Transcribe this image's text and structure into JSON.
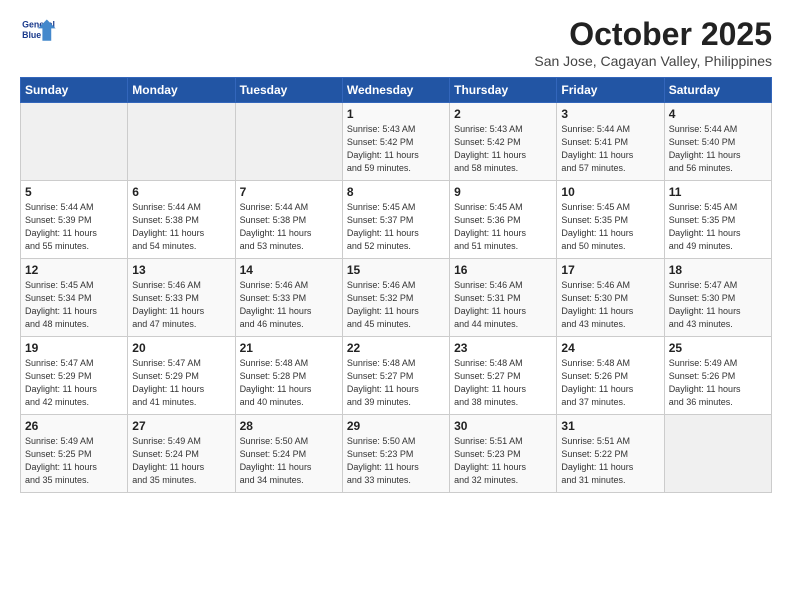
{
  "header": {
    "logo_line1": "General",
    "logo_line2": "Blue",
    "month": "October 2025",
    "location": "San Jose, Cagayan Valley, Philippines"
  },
  "weekdays": [
    "Sunday",
    "Monday",
    "Tuesday",
    "Wednesday",
    "Thursday",
    "Friday",
    "Saturday"
  ],
  "weeks": [
    [
      {
        "day": "",
        "info": ""
      },
      {
        "day": "",
        "info": ""
      },
      {
        "day": "",
        "info": ""
      },
      {
        "day": "1",
        "info": "Sunrise: 5:43 AM\nSunset: 5:42 PM\nDaylight: 11 hours\nand 59 minutes."
      },
      {
        "day": "2",
        "info": "Sunrise: 5:43 AM\nSunset: 5:42 PM\nDaylight: 11 hours\nand 58 minutes."
      },
      {
        "day": "3",
        "info": "Sunrise: 5:44 AM\nSunset: 5:41 PM\nDaylight: 11 hours\nand 57 minutes."
      },
      {
        "day": "4",
        "info": "Sunrise: 5:44 AM\nSunset: 5:40 PM\nDaylight: 11 hours\nand 56 minutes."
      }
    ],
    [
      {
        "day": "5",
        "info": "Sunrise: 5:44 AM\nSunset: 5:39 PM\nDaylight: 11 hours\nand 55 minutes."
      },
      {
        "day": "6",
        "info": "Sunrise: 5:44 AM\nSunset: 5:38 PM\nDaylight: 11 hours\nand 54 minutes."
      },
      {
        "day": "7",
        "info": "Sunrise: 5:44 AM\nSunset: 5:38 PM\nDaylight: 11 hours\nand 53 minutes."
      },
      {
        "day": "8",
        "info": "Sunrise: 5:45 AM\nSunset: 5:37 PM\nDaylight: 11 hours\nand 52 minutes."
      },
      {
        "day": "9",
        "info": "Sunrise: 5:45 AM\nSunset: 5:36 PM\nDaylight: 11 hours\nand 51 minutes."
      },
      {
        "day": "10",
        "info": "Sunrise: 5:45 AM\nSunset: 5:35 PM\nDaylight: 11 hours\nand 50 minutes."
      },
      {
        "day": "11",
        "info": "Sunrise: 5:45 AM\nSunset: 5:35 PM\nDaylight: 11 hours\nand 49 minutes."
      }
    ],
    [
      {
        "day": "12",
        "info": "Sunrise: 5:45 AM\nSunset: 5:34 PM\nDaylight: 11 hours\nand 48 minutes."
      },
      {
        "day": "13",
        "info": "Sunrise: 5:46 AM\nSunset: 5:33 PM\nDaylight: 11 hours\nand 47 minutes."
      },
      {
        "day": "14",
        "info": "Sunrise: 5:46 AM\nSunset: 5:33 PM\nDaylight: 11 hours\nand 46 minutes."
      },
      {
        "day": "15",
        "info": "Sunrise: 5:46 AM\nSunset: 5:32 PM\nDaylight: 11 hours\nand 45 minutes."
      },
      {
        "day": "16",
        "info": "Sunrise: 5:46 AM\nSunset: 5:31 PM\nDaylight: 11 hours\nand 44 minutes."
      },
      {
        "day": "17",
        "info": "Sunrise: 5:46 AM\nSunset: 5:30 PM\nDaylight: 11 hours\nand 43 minutes."
      },
      {
        "day": "18",
        "info": "Sunrise: 5:47 AM\nSunset: 5:30 PM\nDaylight: 11 hours\nand 43 minutes."
      }
    ],
    [
      {
        "day": "19",
        "info": "Sunrise: 5:47 AM\nSunset: 5:29 PM\nDaylight: 11 hours\nand 42 minutes."
      },
      {
        "day": "20",
        "info": "Sunrise: 5:47 AM\nSunset: 5:29 PM\nDaylight: 11 hours\nand 41 minutes."
      },
      {
        "day": "21",
        "info": "Sunrise: 5:48 AM\nSunset: 5:28 PM\nDaylight: 11 hours\nand 40 minutes."
      },
      {
        "day": "22",
        "info": "Sunrise: 5:48 AM\nSunset: 5:27 PM\nDaylight: 11 hours\nand 39 minutes."
      },
      {
        "day": "23",
        "info": "Sunrise: 5:48 AM\nSunset: 5:27 PM\nDaylight: 11 hours\nand 38 minutes."
      },
      {
        "day": "24",
        "info": "Sunrise: 5:48 AM\nSunset: 5:26 PM\nDaylight: 11 hours\nand 37 minutes."
      },
      {
        "day": "25",
        "info": "Sunrise: 5:49 AM\nSunset: 5:26 PM\nDaylight: 11 hours\nand 36 minutes."
      }
    ],
    [
      {
        "day": "26",
        "info": "Sunrise: 5:49 AM\nSunset: 5:25 PM\nDaylight: 11 hours\nand 35 minutes."
      },
      {
        "day": "27",
        "info": "Sunrise: 5:49 AM\nSunset: 5:24 PM\nDaylight: 11 hours\nand 35 minutes."
      },
      {
        "day": "28",
        "info": "Sunrise: 5:50 AM\nSunset: 5:24 PM\nDaylight: 11 hours\nand 34 minutes."
      },
      {
        "day": "29",
        "info": "Sunrise: 5:50 AM\nSunset: 5:23 PM\nDaylight: 11 hours\nand 33 minutes."
      },
      {
        "day": "30",
        "info": "Sunrise: 5:51 AM\nSunset: 5:23 PM\nDaylight: 11 hours\nand 32 minutes."
      },
      {
        "day": "31",
        "info": "Sunrise: 5:51 AM\nSunset: 5:22 PM\nDaylight: 11 hours\nand 31 minutes."
      },
      {
        "day": "",
        "info": ""
      }
    ]
  ]
}
